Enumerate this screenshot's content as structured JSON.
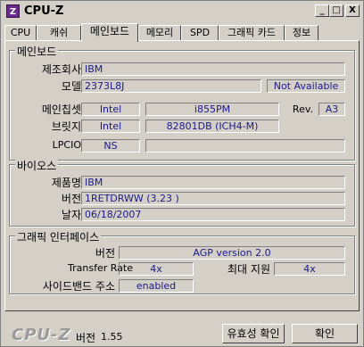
{
  "window": {
    "title": "CPU-Z",
    "icon_letter": "Z",
    "minimize": "_",
    "maximize": "□",
    "close": "X"
  },
  "tabs": [
    "CPU",
    "캐쉬",
    "메인보드",
    "메모리",
    "SPD",
    "그래픽 카드",
    "정보"
  ],
  "active_tab": "메인보드",
  "mainboard": {
    "legend": "메인보드",
    "manufacturer_label": "제조회사",
    "manufacturer": "IBM",
    "model_label": "모델",
    "model": "2373L8J",
    "model_revision": "Not Available",
    "chipset_label": "메인칩셋",
    "chipset_vendor": "Intel",
    "chipset_model": "i855PM",
    "rev_label": "Rev.",
    "rev": "A3",
    "southbridge_label": "브릿지",
    "southbridge_vendor": "Intel",
    "southbridge_model": "82801DB (ICH4-M)",
    "lpcio_label": "LPCIO",
    "lpcio_vendor": "NS",
    "lpcio_model": ""
  },
  "bios": {
    "legend": "바이오스",
    "brand_label": "제품명",
    "brand": "IBM",
    "version_label": "버전",
    "version": "1RETDRWW (3.23 )",
    "date_label": "날자",
    "date": "06/18/2007"
  },
  "graphic_interface": {
    "legend": "그래픽 인터페이스",
    "version_label": "버전",
    "version": "AGP version 2.0",
    "transfer_rate_label": "Transfer Rate",
    "transfer_rate": "4x",
    "max_supported_label": "최대 지원",
    "max_supported": "4x",
    "side_band_label": "사이드밴드 주소",
    "side_band": "enabled"
  },
  "footer": {
    "brand": "CPU-Z",
    "version_label": "버전",
    "version": "1.55",
    "validate_button": "유효성 확인",
    "ok_button": "확인"
  }
}
